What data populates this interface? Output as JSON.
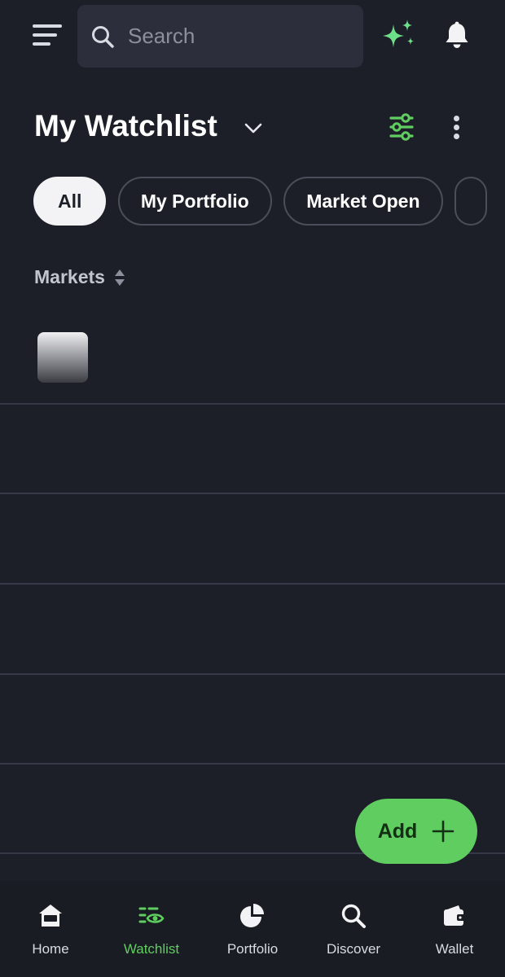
{
  "header": {
    "search_placeholder": "Search"
  },
  "watchlist": {
    "title": "My Watchlist"
  },
  "chips": [
    {
      "label": "All",
      "active": true
    },
    {
      "label": "My Portfolio",
      "active": false
    },
    {
      "label": "Market Open",
      "active": false
    }
  ],
  "list": {
    "sort_label": "Markets"
  },
  "fab": {
    "label": "Add"
  },
  "nav": [
    {
      "label": "Home",
      "icon": "home-icon"
    },
    {
      "label": "Watchlist",
      "icon": "watchlist-icon",
      "active": true
    },
    {
      "label": "Portfolio",
      "icon": "pie-chart-icon"
    },
    {
      "label": "Discover",
      "icon": "search-icon"
    },
    {
      "label": "Wallet",
      "icon": "wallet-icon"
    }
  ],
  "colors": {
    "background": "#1d1f28",
    "accent": "#5fcd5f",
    "surface": "#2c2f3b"
  }
}
